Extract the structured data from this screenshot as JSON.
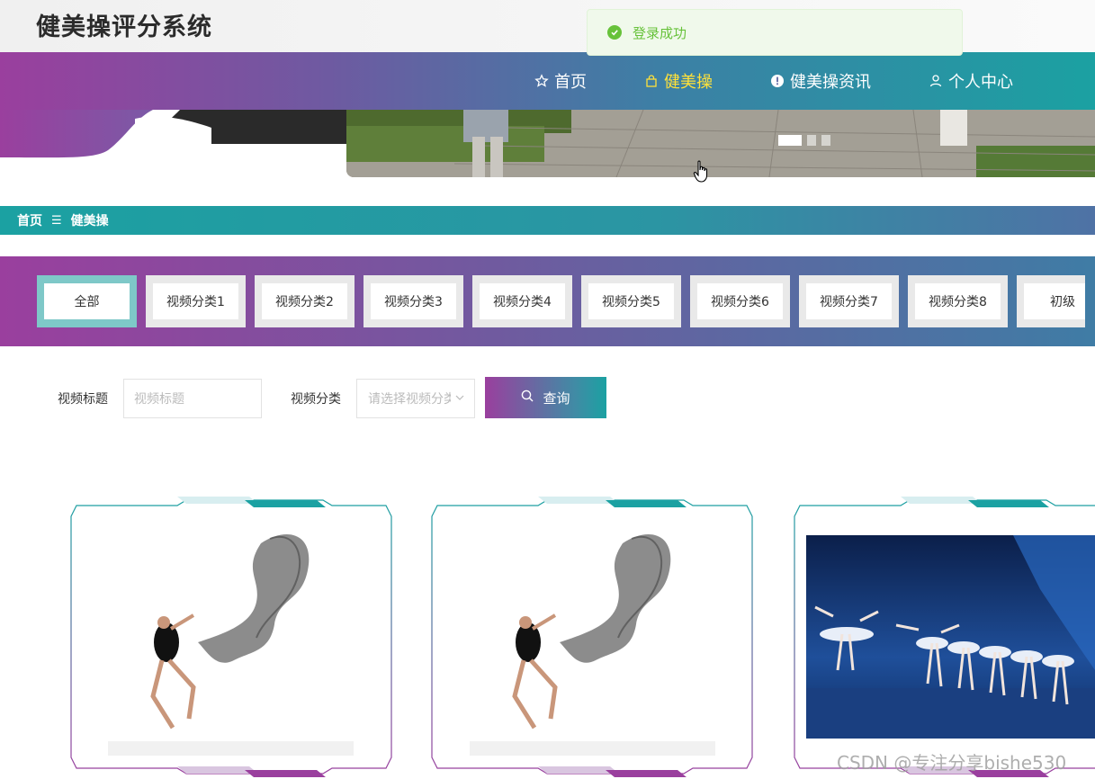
{
  "site": {
    "title": "健美操评分系统"
  },
  "toast": {
    "message": "登录成功",
    "color": "#67c23a"
  },
  "nav": {
    "items": [
      {
        "label": "首页",
        "icon": "star-icon",
        "active": false
      },
      {
        "label": "健美操",
        "icon": "bag-icon",
        "active": true
      },
      {
        "label": "健美操资讯",
        "icon": "info-icon",
        "active": false
      },
      {
        "label": "个人中心",
        "icon": "user-icon",
        "active": false
      }
    ]
  },
  "banner": {
    "active_slide": 1,
    "slide_count": 3
  },
  "breadcrumb": {
    "home": "首页",
    "separator": "☰",
    "current": "健美操"
  },
  "categories": [
    "全部",
    "视频分类1",
    "视频分类2",
    "视频分类3",
    "视频分类4",
    "视频分类5",
    "视频分类6",
    "视频分类7",
    "视频分类8",
    "初级"
  ],
  "search": {
    "title_label": "视频标题",
    "title_placeholder": "视频标题",
    "category_label": "视频分类",
    "category_placeholder": "请选择视频分类",
    "button_label": "查询"
  },
  "cards": [
    {
      "image": "dancer-with-scarf-image"
    },
    {
      "image": "dancer-with-scarf-image"
    },
    {
      "image": "ballet-swan-lake-image"
    }
  ],
  "watermark": "CSDN @专注分享bishe530",
  "colors": {
    "accent_purple": "#9a3f9e",
    "accent_teal": "#1ba1a2",
    "active_nav": "#ffe13a"
  }
}
